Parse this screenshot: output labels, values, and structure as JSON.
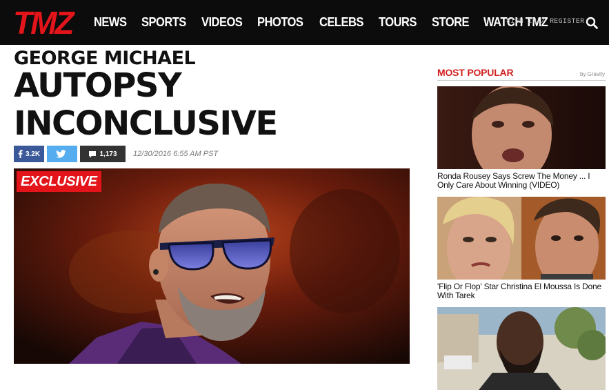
{
  "brand": {
    "name": "TMZ"
  },
  "nav": {
    "items": [
      "NEWS",
      "SPORTS",
      "VIDEOS",
      "PHOTOS",
      "CELEBS",
      "TOURS",
      "STORE",
      "WATCH TMZ"
    ],
    "signin": "SIGN IN / REGISTER"
  },
  "article": {
    "kicker": "GEORGE MICHAEL",
    "headline_line1": "AUTOPSY",
    "headline_line2": "INCONCLUSIVE",
    "share": {
      "facebook_count": "3.2K",
      "comments_count": "1,173"
    },
    "timestamp": "12/30/2016 6:55 AM PST",
    "badge": "EXCLUSIVE"
  },
  "sidebar": {
    "title": "MOST POPULAR",
    "provider": "by Gravity",
    "items": [
      {
        "caption": "Ronda Rousey Says Screw The Money ... I Only Care About Winning (VIDEO)"
      },
      {
        "caption": "'Flip Or Flop' Star Christina El Moussa Is Done With Tarek"
      },
      {
        "caption": ""
      }
    ]
  },
  "colors": {
    "nav_bg": "#0c0c0c",
    "brand_red": "#e4141b",
    "facebook": "#3b5998",
    "twitter": "#55acee",
    "comments": "#333333"
  }
}
